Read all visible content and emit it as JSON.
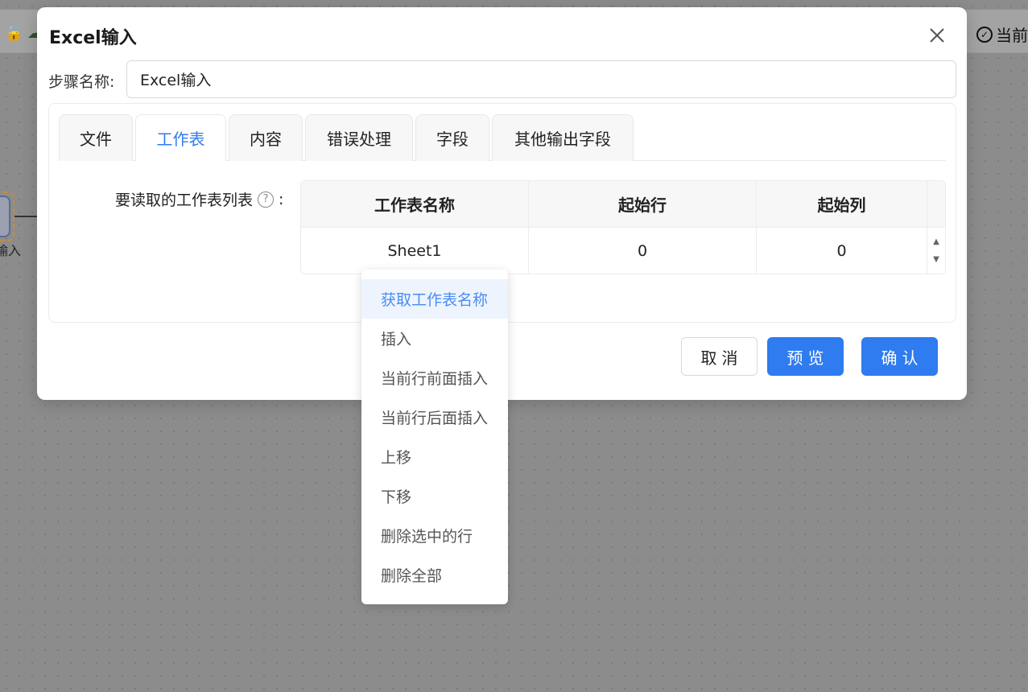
{
  "background": {
    "status_text": "当前",
    "node_label": "输入"
  },
  "dialog": {
    "title": "Excel输入",
    "step_name_label": "步骤名称:",
    "step_name_value": "Excel输入",
    "tabs": [
      {
        "label": "文件"
      },
      {
        "label": "工作表"
      },
      {
        "label": "内容"
      },
      {
        "label": "错误处理"
      },
      {
        "label": "字段"
      },
      {
        "label": "其他输出字段"
      }
    ],
    "active_tab": "工作表",
    "sheet_list_label": "要读取的工作表列表",
    "table": {
      "columns": [
        "工作表名称",
        "起始行",
        "起始列"
      ],
      "rows": [
        [
          "Sheet1",
          "0",
          "0"
        ]
      ]
    },
    "buttons": {
      "cancel": "取消",
      "preview": "预览",
      "confirm": "确认"
    }
  },
  "context_menu": {
    "items": [
      {
        "label": "获取工作表名称"
      },
      {
        "label": "插入"
      },
      {
        "label": "当前行前面插入"
      },
      {
        "label": "当前行后面插入"
      },
      {
        "label": "上移"
      },
      {
        "label": "下移"
      },
      {
        "label": "删除选中的行"
      },
      {
        "label": "删除全部"
      }
    ]
  },
  "colors": {
    "accent": "#2f7bf0",
    "menu_hover_bg": "#eef4fe"
  }
}
